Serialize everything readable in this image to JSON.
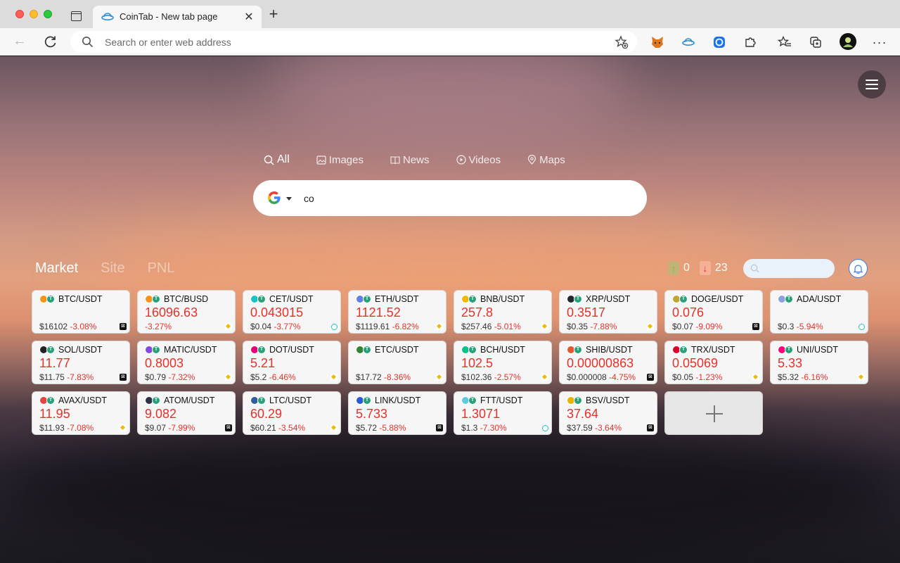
{
  "browser": {
    "tab_title": "CoinTab - New tab page",
    "tab_close": "✕",
    "new_tab": "+",
    "address_placeholder": "Search or enter web address"
  },
  "search": {
    "tabs": [
      "All",
      "Images",
      "News",
      "Videos",
      "Maps"
    ],
    "active_tab": "All",
    "engine_icon": "google-logo",
    "value": "co"
  },
  "market": {
    "tabs": [
      "Market",
      "Site",
      "PNL"
    ],
    "active_tab": "Market",
    "up_count": "0",
    "down_count": "23",
    "colors": {
      "down": "#e4322b",
      "up": "#6fbf3a"
    },
    "cards": [
      {
        "pair": "BTC/USDT",
        "price": "",
        "sub_price": "$16102",
        "change": "-3.08%",
        "icon": "#f7931a",
        "exchange": "okx"
      },
      {
        "pair": "BTC/BUSD",
        "price": "16096.63",
        "sub_price": "",
        "change": "-3.27%",
        "icon": "#f7931a",
        "exchange": "binance"
      },
      {
        "pair": "CET/USDT",
        "price": "0.043015",
        "sub_price": "$0.04",
        "change": "-3.77%",
        "icon": "#19c3c5",
        "exchange": "coinex"
      },
      {
        "pair": "ETH/USDT",
        "price": "1121.52",
        "sub_price": "$1119.61",
        "change": "-6.82%",
        "icon": "#627eea",
        "exchange": "binance"
      },
      {
        "pair": "BNB/USDT",
        "price": "257.8",
        "sub_price": "$257.46",
        "change": "-5.01%",
        "icon": "#f0b90b",
        "exchange": "binance"
      },
      {
        "pair": "XRP/USDT",
        "price": "0.3517",
        "sub_price": "$0.35",
        "change": "-7.88%",
        "icon": "#23292f",
        "exchange": "binance"
      },
      {
        "pair": "DOGE/USDT",
        "price": "0.076",
        "sub_price": "$0.07",
        "change": "-9.09%",
        "icon": "#c2a633",
        "exchange": "okx"
      },
      {
        "pair": "ADA/USDT",
        "price": "",
        "sub_price": "$0.3",
        "change": "-5.94%",
        "icon": "#8aa0e0",
        "exchange": "coinex"
      },
      {
        "pair": "SOL/USDT",
        "price": "11.77",
        "sub_price": "$11.75",
        "change": "-7.83%",
        "icon": "#222222",
        "exchange": "okx"
      },
      {
        "pair": "MATIC/USDT",
        "price": "0.8003",
        "sub_price": "$0.79",
        "change": "-7.32%",
        "icon": "#8247e5",
        "exchange": "binance"
      },
      {
        "pair": "DOT/USDT",
        "price": "5.21",
        "sub_price": "$5.2",
        "change": "-6.46%",
        "icon": "#e6007a",
        "exchange": "binance"
      },
      {
        "pair": "ETC/USDT",
        "price": "",
        "sub_price": "$17.72",
        "change": "-8.36%",
        "icon": "#328332",
        "exchange": "binance"
      },
      {
        "pair": "BCH/USDT",
        "price": "102.5",
        "sub_price": "$102.36",
        "change": "-2.57%",
        "icon": "#0ac18e",
        "exchange": "binance"
      },
      {
        "pair": "SHIB/USDT",
        "price": "0.00000863",
        "sub_price": "$0.000008",
        "change": "-4.75%",
        "icon": "#e4572e",
        "exchange": "okx"
      },
      {
        "pair": "TRX/USDT",
        "price": "0.05069",
        "sub_price": "$0.05",
        "change": "-1.23%",
        "icon": "#d9012c",
        "exchange": "binance"
      },
      {
        "pair": "UNI/USDT",
        "price": "5.33",
        "sub_price": "$5.32",
        "change": "-6.16%",
        "icon": "#ff007a",
        "exchange": "binance"
      },
      {
        "pair": "AVAX/USDT",
        "price": "11.95",
        "sub_price": "$11.93",
        "change": "-7.08%",
        "icon": "#e84142",
        "exchange": "binance"
      },
      {
        "pair": "ATOM/USDT",
        "price": "9.082",
        "sub_price": "$9.07",
        "change": "-7.99%",
        "icon": "#2e3148",
        "exchange": "okx"
      },
      {
        "pair": "LTC/USDT",
        "price": "60.29",
        "sub_price": "$60.21",
        "change": "-3.54%",
        "icon": "#345d9d",
        "exchange": "binance"
      },
      {
        "pair": "LINK/USDT",
        "price": "5.733",
        "sub_price": "$5.72",
        "change": "-5.88%",
        "icon": "#2a5ada",
        "exchange": "okx"
      },
      {
        "pair": "FTT/USDT",
        "price": "1.3071",
        "sub_price": "$1.3",
        "change": "-7.30%",
        "icon": "#5fcade",
        "exchange": "coinex"
      },
      {
        "pair": "BSV/USDT",
        "price": "37.64",
        "sub_price": "$37.59",
        "change": "-3.64%",
        "icon": "#eab300",
        "exchange": "okx"
      }
    ]
  }
}
